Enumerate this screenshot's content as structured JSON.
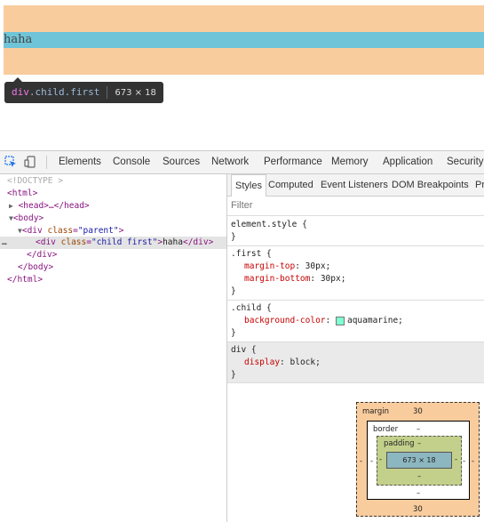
{
  "preview": {
    "child_text": "haha",
    "tooltip": {
      "tag": "div",
      "classes": ".child.first",
      "size": "673 × 18"
    }
  },
  "toolbar": {
    "tabs": [
      "Elements",
      "Console",
      "Sources",
      "Network",
      "Performance",
      "Memory",
      "Application",
      "Security"
    ]
  },
  "dom": {
    "doctype": "<!DOCTYPE >",
    "html_open": "<html>",
    "head": "<head>…</head>",
    "body_open": "<body>",
    "parent_open_tag": "div",
    "parent_attr": "class",
    "parent_value": "\"parent\"",
    "child_open_tag": "div",
    "child_attr": "class",
    "child_value": "\"child first\"",
    "child_text": "haha",
    "child_close": "</div>",
    "parent_close": "</div>",
    "body_close": "</body>",
    "html_close": "</html>",
    "selected_marker": "…"
  },
  "styles": {
    "subtabs": [
      "Styles",
      "Computed",
      "Event Listeners",
      "DOM Breakpoints",
      "Pr"
    ],
    "filter_placeholder": "Filter",
    "element_style": "element.style {",
    "close_brace": "}",
    "first_selector": ".first {",
    "first_props": [
      {
        "name": "margin-top",
        "value": "30px;"
      },
      {
        "name": "margin-bottom",
        "value": "30px;"
      }
    ],
    "child_selector": ".child {",
    "child_prop": {
      "name": "background-color",
      "value": "aquamarine;",
      "swatch_color": "#7fffd4"
    },
    "div_selector": "div {",
    "div_prop": {
      "name": "display",
      "value": "block;"
    }
  },
  "box_model": {
    "margin_label": "margin",
    "margin_top": "30",
    "margin_bottom": "30",
    "margin_left": "-",
    "margin_right": "-",
    "border_label": "border",
    "border_value": "–",
    "border_left": "-",
    "border_right": "-",
    "border_bottom": "–",
    "padding_label": "padding",
    "padding_top": "–",
    "padding_bottom": "–",
    "padding_left": "-",
    "padding_right": "-",
    "content_size": "673 × 18"
  },
  "colors": {
    "margin_highlight": "#f9cc9d",
    "content_highlight": "#6fc4d8",
    "tag": "#881280",
    "attr_name": "#994500",
    "attr_value": "#1a1aa6",
    "css_prop": "#c80000"
  }
}
